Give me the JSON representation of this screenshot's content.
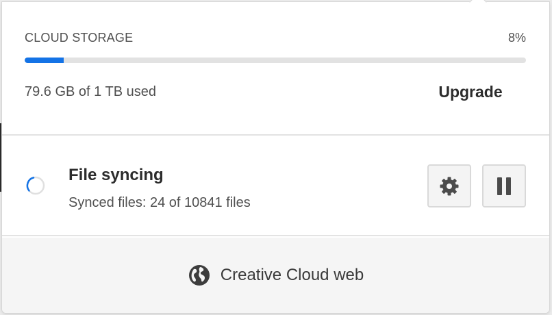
{
  "storage": {
    "title": "CLOUD STORAGE",
    "percent_label": "8%",
    "used_fraction": 0.078,
    "used_text": "79.6 GB of 1 TB used",
    "upgrade_label": "Upgrade",
    "bar_color": "#1473e6"
  },
  "sync": {
    "title": "File syncing",
    "subtitle": "Synced files: 24 of 10841 files",
    "icons": {
      "status": "spinner-icon",
      "settings": "gear-icon",
      "pause": "pause-icon"
    }
  },
  "web": {
    "label": "Creative Cloud web",
    "icon": "globe-icon"
  }
}
